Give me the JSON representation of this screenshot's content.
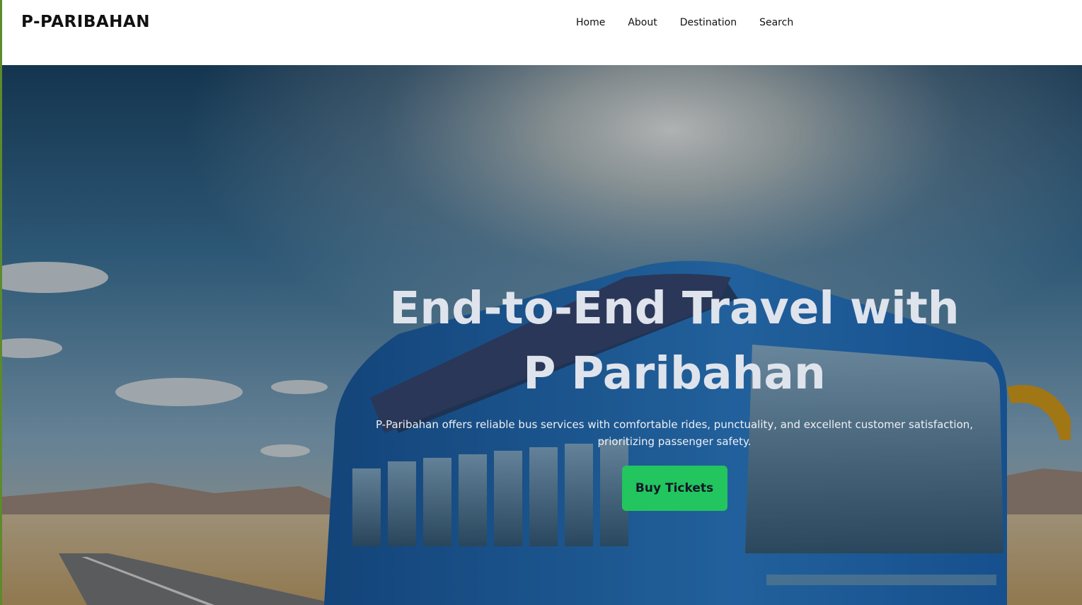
{
  "brand": {
    "name": "P-PARIBAHAN"
  },
  "nav": {
    "items": [
      {
        "label": "Home"
      },
      {
        "label": "About"
      },
      {
        "label": "Destination"
      },
      {
        "label": "Search"
      }
    ]
  },
  "hero": {
    "title_line1": "End-to-End Travel with",
    "title_line2": "P Paribahan",
    "description": "P-Paribahan offers reliable bus services with comfortable rides, punctuality, and excellent customer satisfaction, prioritizing passenger safety.",
    "cta_label": "Buy Tickets",
    "image_subject": "blue solar-powered bus on desert highway",
    "overlay_color": "rgba(0,0,0,0.28)"
  },
  "colors": {
    "accent": "#22c55e",
    "brand_text": "#111111",
    "hero_title": "#dfe3ec"
  }
}
